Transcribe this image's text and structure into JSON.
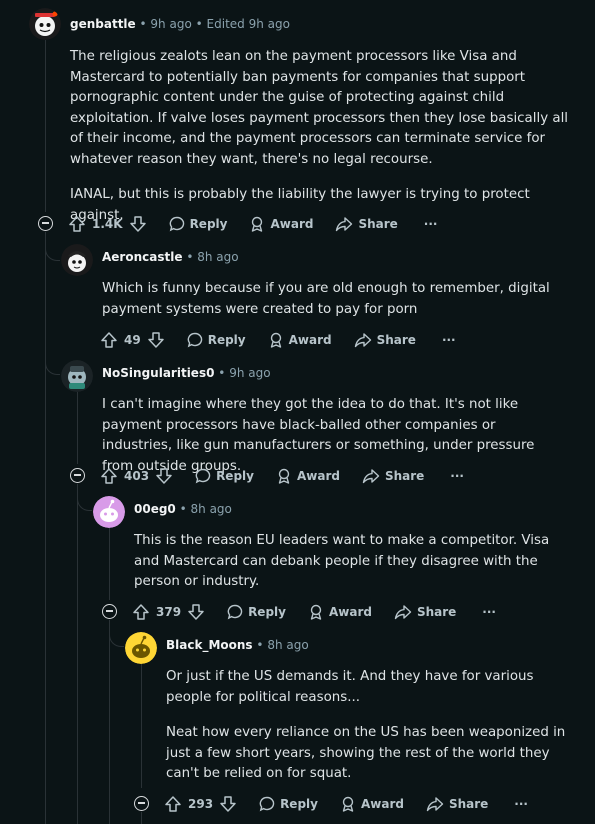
{
  "labels": {
    "reply": "Reply",
    "award": "Award",
    "share": "Share",
    "more": "···"
  },
  "comments": [
    {
      "user": "genbattle",
      "time": "9h ago",
      "edited": "Edited 9h ago",
      "paragraphs": [
        "The religious zealots lean on the payment processors like Visa and Mastercard to potentially ban payments for companies that support pornographic content under the guise of protecting against child exploitation. If valve loses payment processors then they lose basically all of their income, and the payment processors can terminate service for whatever reason they want, there's no legal recourse.",
        "IANAL, but this is probably the liability the lawyer is trying to protect against."
      ],
      "votes": "1.4K"
    },
    {
      "user": "Aeroncastle",
      "time": "8h ago",
      "paragraphs": [
        "Which is funny because if you are old enough to remember, digital payment systems were created to pay for porn"
      ],
      "votes": "49"
    },
    {
      "user": "NoSingularities0",
      "time": "9h ago",
      "paragraphs": [
        "I can't imagine where they got the idea to do that. It's not like payment processors have black-balled other companies or industries, like gun manufacturers or something, under pressure from outside groups."
      ],
      "votes": "403"
    },
    {
      "user": "00eg0",
      "time": "8h ago",
      "paragraphs": [
        "This is the reason EU leaders want to make a competitor. Visa and Mastercard can debank people if they disagree with the person or industry."
      ],
      "votes": "379"
    },
    {
      "user": "Black_Moons",
      "time": "8h ago",
      "paragraphs": [
        "Or just if the US demands it. And they have for various people for political reasons...",
        "Neat how every reliance on the US has been weaponized in just a few short years, showing the rest of the world they can't be relied on for squat."
      ],
      "votes": "293"
    }
  ],
  "colors": {
    "background": "#0b1416",
    "thread_line": "#2a3236",
    "meta": "#8ba2ad"
  },
  "icons": [
    "upvote-icon",
    "downvote-icon",
    "reply-bubble-icon",
    "award-icon",
    "share-icon",
    "collapse-icon"
  ]
}
